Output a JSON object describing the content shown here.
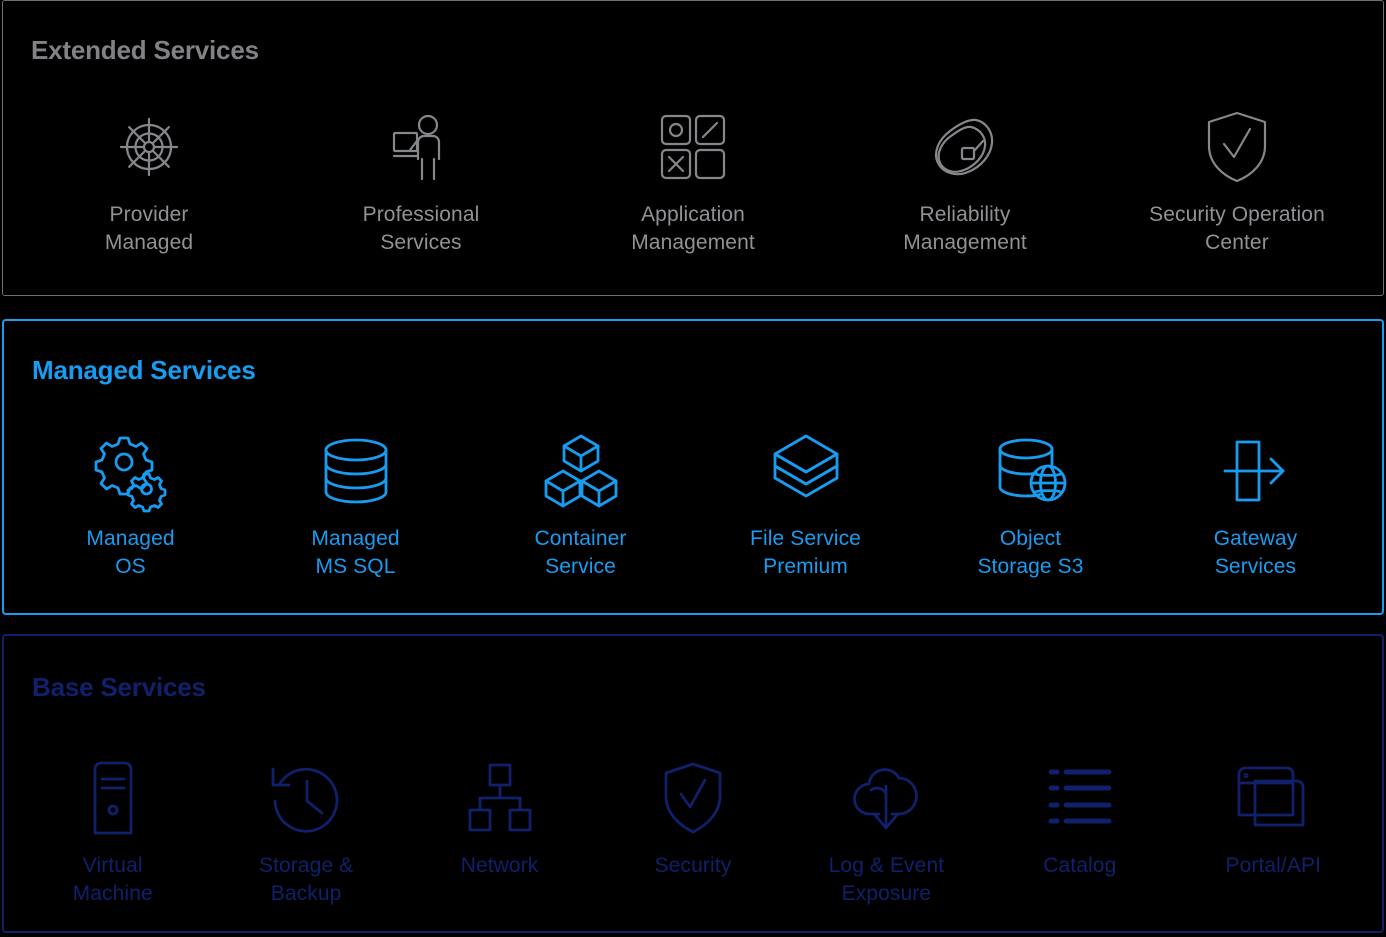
{
  "sections": [
    {
      "id": "extended-services",
      "title": "Extended Services",
      "accent": "#808285",
      "tone": "gray",
      "items": [
        {
          "label": "Provider\nManaged",
          "icon": "ships-wheel-icon"
        },
        {
          "label": "Professional\nServices",
          "icon": "presenter-person-icon"
        },
        {
          "label": "Application\nManagement",
          "icon": "four-squares-icon"
        },
        {
          "label": "Reliability\nManagement",
          "icon": "carabiner-icon"
        },
        {
          "label": "Security Operation\nCenter",
          "icon": "shield-check-icon"
        }
      ]
    },
    {
      "id": "managed-services",
      "title": "Managed Services",
      "accent": "#189cf0",
      "tone": "blue",
      "items": [
        {
          "label": "Managed\nOS",
          "icon": "gears-icon"
        },
        {
          "label": "Managed\nMS SQL",
          "icon": "database-icon"
        },
        {
          "label": "Container\nService",
          "icon": "cubes-icon"
        },
        {
          "label": "File Service\nPremium",
          "icon": "layers-icon"
        },
        {
          "label": "Object\nStorage S3",
          "icon": "database-globe-icon"
        },
        {
          "label": "Gateway\nServices",
          "icon": "gateway-arrow-icon"
        }
      ]
    },
    {
      "id": "base-services",
      "title": "Base Services",
      "accent": "#10206b",
      "tone": "navy",
      "items": [
        {
          "label": "Virtual\nMachine",
          "icon": "server-tower-icon"
        },
        {
          "label": "Storage &\nBackup",
          "icon": "clock-restore-icon"
        },
        {
          "label": "Network",
          "icon": "network-nodes-icon"
        },
        {
          "label": "Security",
          "icon": "shield-check-icon"
        },
        {
          "label": "Log & Event\nExposure",
          "icon": "cloud-download-icon"
        },
        {
          "label": "Catalog",
          "icon": "list-lines-icon"
        },
        {
          "label": "Portal/API",
          "icon": "browser-windows-icon"
        }
      ]
    }
  ]
}
